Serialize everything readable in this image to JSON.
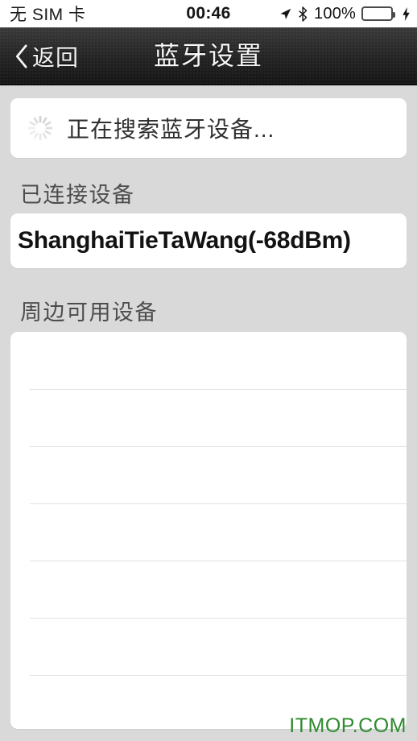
{
  "status_bar": {
    "carrier": "无 SIM 卡",
    "time": "00:46",
    "battery_percent": "100%",
    "icons": {
      "location": "location-arrow-icon",
      "bluetooth": "bluetooth-icon",
      "battery": "battery-full-icon",
      "charging": "charging-bolt-icon"
    },
    "colors": {
      "battery_fill": "#4cd455",
      "battery_outline": "#4a4a4a"
    }
  },
  "nav_bar": {
    "back_label": "返回",
    "back_icon": "chevron-left-icon",
    "title": "蓝牙设置"
  },
  "searching": {
    "icon": "spinner-icon",
    "label": "正在搜索蓝牙设备..."
  },
  "connected_section": {
    "header": "已连接设备",
    "devices": [
      {
        "name": "ShanghaiTieTaWang(-68dBm)"
      }
    ]
  },
  "available_section": {
    "header": "周边可用设备",
    "devices": [
      {
        "name": ""
      },
      {
        "name": ""
      },
      {
        "name": ""
      },
      {
        "name": ""
      },
      {
        "name": ""
      },
      {
        "name": ""
      },
      {
        "name": ""
      }
    ]
  },
  "watermark": {
    "text": "ITMOP.COM",
    "color": "#2e8b2e"
  }
}
